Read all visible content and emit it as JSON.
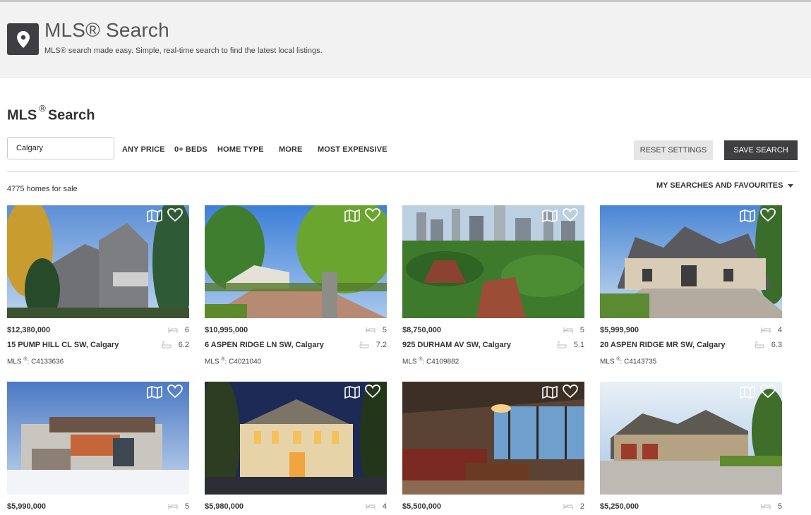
{
  "header": {
    "title": "MLS® Search",
    "subtitle": "MLS® search made easy. Simple, real-time search to find the latest local listings."
  },
  "search": {
    "section_title_a": "MLS",
    "section_title_reg": "®",
    "section_title_b": "Search",
    "city_value": "Calgary",
    "filters": [
      "ANY PRICE",
      "0+ BEDS",
      "HOME TYPE",
      "MORE",
      "MOST EXPENSIVE"
    ],
    "reset_label": "RESET SETTINGS",
    "save_label": "SAVE SEARCH"
  },
  "results": {
    "count": "4775 homes for sale",
    "my_searches": "MY SEARCHES AND FAVOURITES"
  },
  "listings": [
    {
      "price": "$12,380,000",
      "address": "15 PUMP HILL CL SW, Calgary",
      "beds": "6",
      "baths": "6.2",
      "mls_prefix": "MLS",
      "mls_reg": "®",
      "mls_id": ": C4133636"
    },
    {
      "price": "$10,995,000",
      "address": "6 ASPEN RIDGE LN SW, Calgary",
      "beds": "5",
      "baths": "7.2",
      "mls_prefix": "MLS",
      "mls_reg": "®",
      "mls_id": ": C4021040"
    },
    {
      "price": "$8,750,000",
      "address": "925 DURHAM AV SW, Calgary",
      "beds": "5",
      "baths": "5.1",
      "mls_prefix": "MLS",
      "mls_reg": "®",
      "mls_id": ": C4109882"
    },
    {
      "price": "$5,999,900",
      "address": "20 ASPEN RIDGE MR SW, Calgary",
      "beds": "4",
      "baths": "6.3",
      "mls_prefix": "MLS",
      "mls_reg": "®",
      "mls_id": ": C4143735"
    },
    {
      "price": "$5,990,000",
      "beds": "5"
    },
    {
      "price": "$5,980,000",
      "beds": "4"
    },
    {
      "price": "$5,500,000",
      "beds": "2"
    },
    {
      "price": "$5,250,000",
      "beds": "5"
    }
  ],
  "colors": {
    "hero_bg": "#f2f2f3",
    "dark_button": "#3f3f41",
    "light_button": "#e6e6e6"
  },
  "icons": [
    "location-pin-icon",
    "map-icon",
    "heart-icon",
    "bed-icon",
    "bath-icon",
    "caret-down-icon"
  ]
}
